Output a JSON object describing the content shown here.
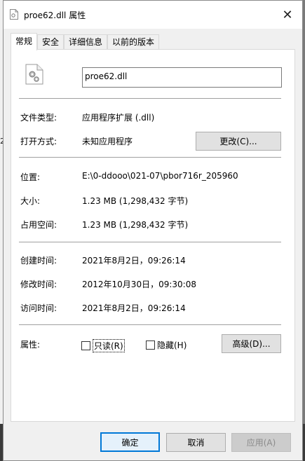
{
  "window": {
    "title": "proe62.dll 属性",
    "close_glyph": "✕"
  },
  "tabs": [
    {
      "label": "常规"
    },
    {
      "label": "安全"
    },
    {
      "label": "详细信息"
    },
    {
      "label": "以前的版本"
    }
  ],
  "general": {
    "file_name": "proe62.dll",
    "file_type_label": "文件类型:",
    "file_type_value": "应用程序扩展 (.dll)",
    "opens_with_label": "打开方式:",
    "opens_with_value": "未知应用程序",
    "change_button": "更改(C)...",
    "location_label": "位置:",
    "location_value": "E:\\0-ddooo\\021-07\\pbor716r_205960",
    "size_label": "大小:",
    "size_value": "1.23 MB (1,298,432 字节)",
    "size_on_disk_label": "占用空间:",
    "size_on_disk_value": "1.23 MB (1,298,432 字节)",
    "created_label": "创建时间:",
    "created_value": "2021年8月2日，09:26:14",
    "modified_label": "修改时间:",
    "modified_value": "2012年10月30日，09:30:08",
    "accessed_label": "访问时间:",
    "accessed_value": "2021年8月2日，09:26:14",
    "attributes_label": "属性:",
    "readonly_label": "只读(R)",
    "hidden_label": "隐藏(H)",
    "advanced_button": "高级(D)..."
  },
  "footer": {
    "ok_button": "确定",
    "cancel_button": "取消",
    "apply_button": "应用(A)"
  },
  "background": {
    "edge_char": "2"
  },
  "colors": {
    "accent": "#0078d7"
  }
}
